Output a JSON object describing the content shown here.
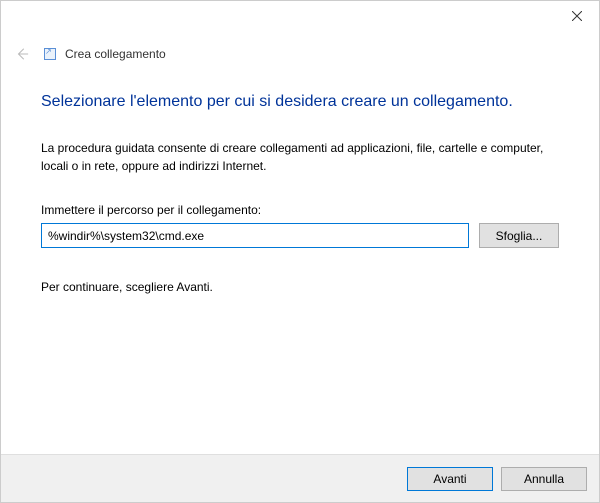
{
  "window": {
    "breadcrumb_title": "Crea collegamento"
  },
  "main": {
    "heading": "Selezionare l'elemento per cui si desidera creare un collegamento.",
    "description": "La procedura guidata consente di creare collegamenti ad applicazioni, file, cartelle e computer, locali o in rete, oppure ad indirizzi Internet.",
    "field_label": "Immettere il percorso per il collegamento:",
    "input_value": "%windir%\\system32\\cmd.exe",
    "browse_label": "Sfoglia...",
    "continue_hint": "Per continuare, scegliere Avanti."
  },
  "footer": {
    "next_label": "Avanti",
    "cancel_label": "Annulla"
  }
}
